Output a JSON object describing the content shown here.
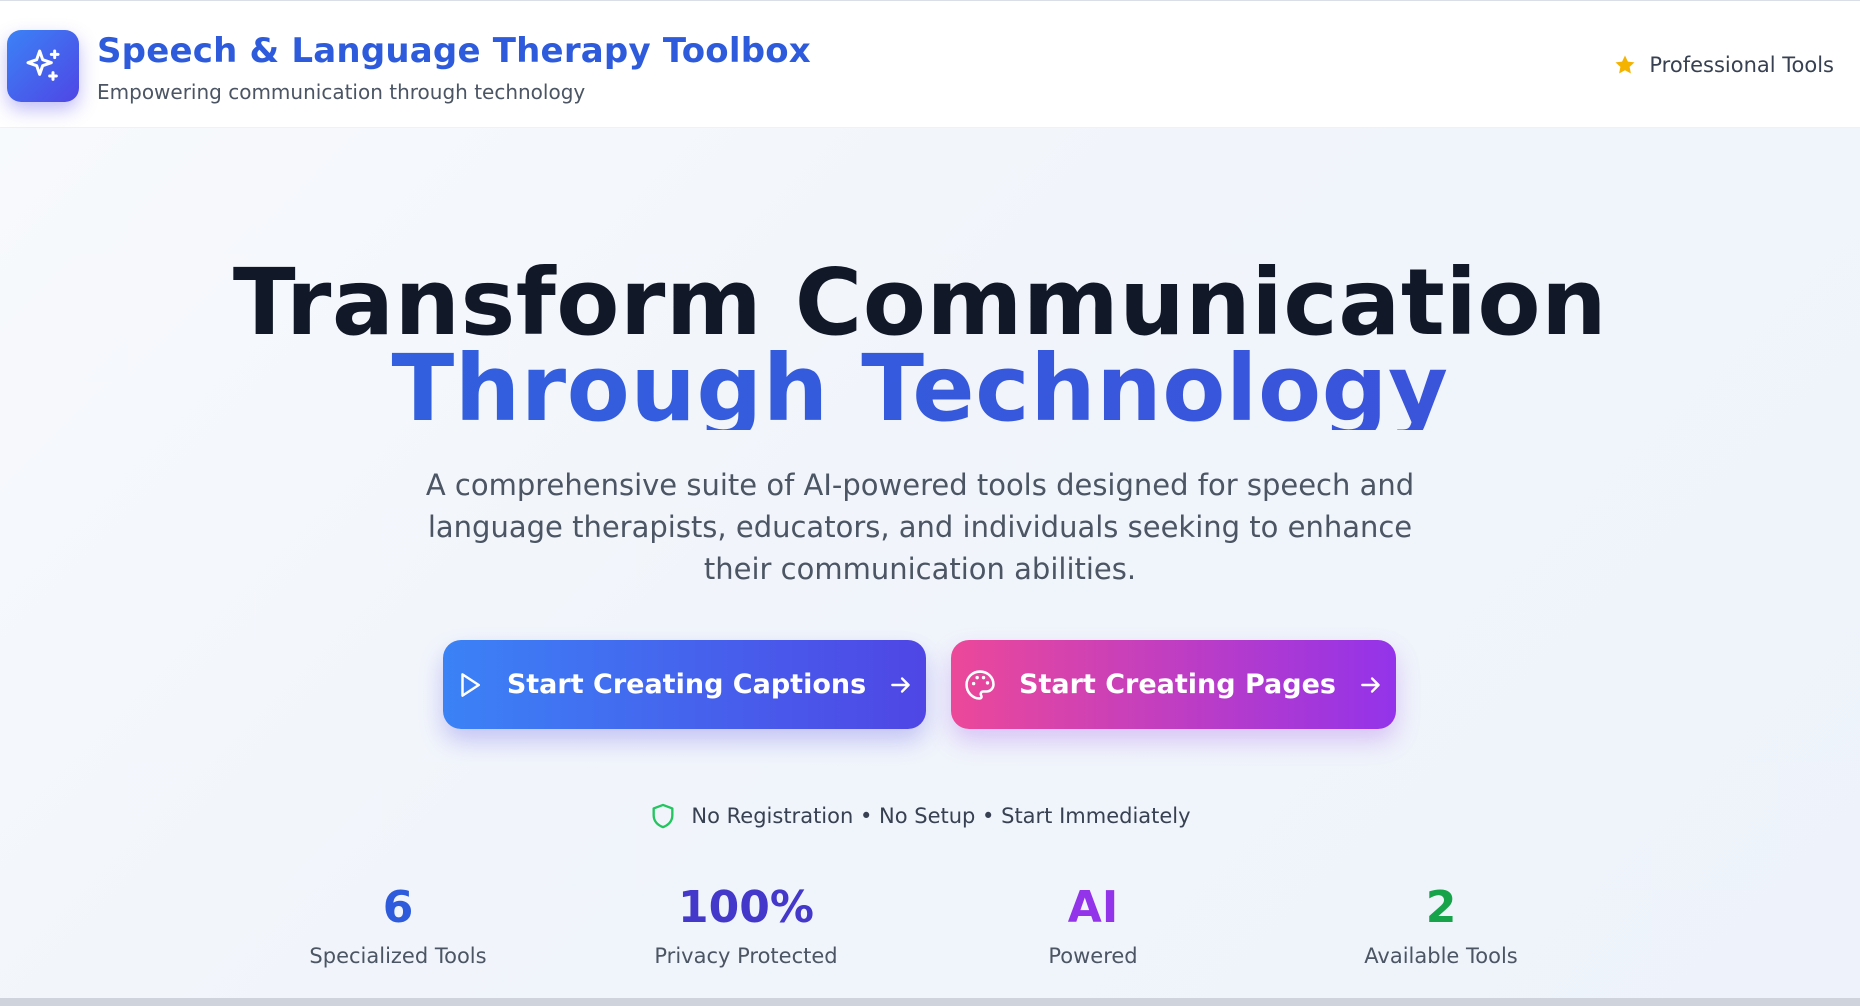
{
  "header": {
    "logo_icon": "sparkles-icon",
    "title": "Speech & Language Therapy Toolbox",
    "subtitle": "Empowering communication through technology",
    "badge_label": "Professional Tools",
    "badge_icon": "star-icon"
  },
  "hero": {
    "title_line1": "Transform Communication",
    "title_line2": "Through Technology",
    "description": "A comprehensive suite of AI-powered tools designed for speech and language therapists, educators, and individuals seeking to enhance their communication abilities."
  },
  "buttons": {
    "captions": {
      "label": "Start Creating Captions",
      "icon": "play-icon",
      "trailing_icon": "arrow-right-icon"
    },
    "pages": {
      "label": "Start Creating Pages",
      "icon": "palette-icon",
      "trailing_icon": "arrow-right-icon"
    }
  },
  "trust": {
    "icon": "shield-icon",
    "text": "No Registration • No Setup • Start Immediately"
  },
  "stats": [
    {
      "value": "6",
      "label": "Specialized Tools",
      "color": "#2d5bdc"
    },
    {
      "value": "100%",
      "label": "Privacy Protected",
      "color": "#4338ca"
    },
    {
      "value": "AI",
      "label": "Powered",
      "color": "#9333ea"
    },
    {
      "value": "2",
      "label": "Available Tools",
      "color": "#16a34a"
    }
  ],
  "colors": {
    "brand_blue": "#2d5bdc",
    "star_gold": "#f5b301",
    "shield_green": "#22c55e"
  }
}
